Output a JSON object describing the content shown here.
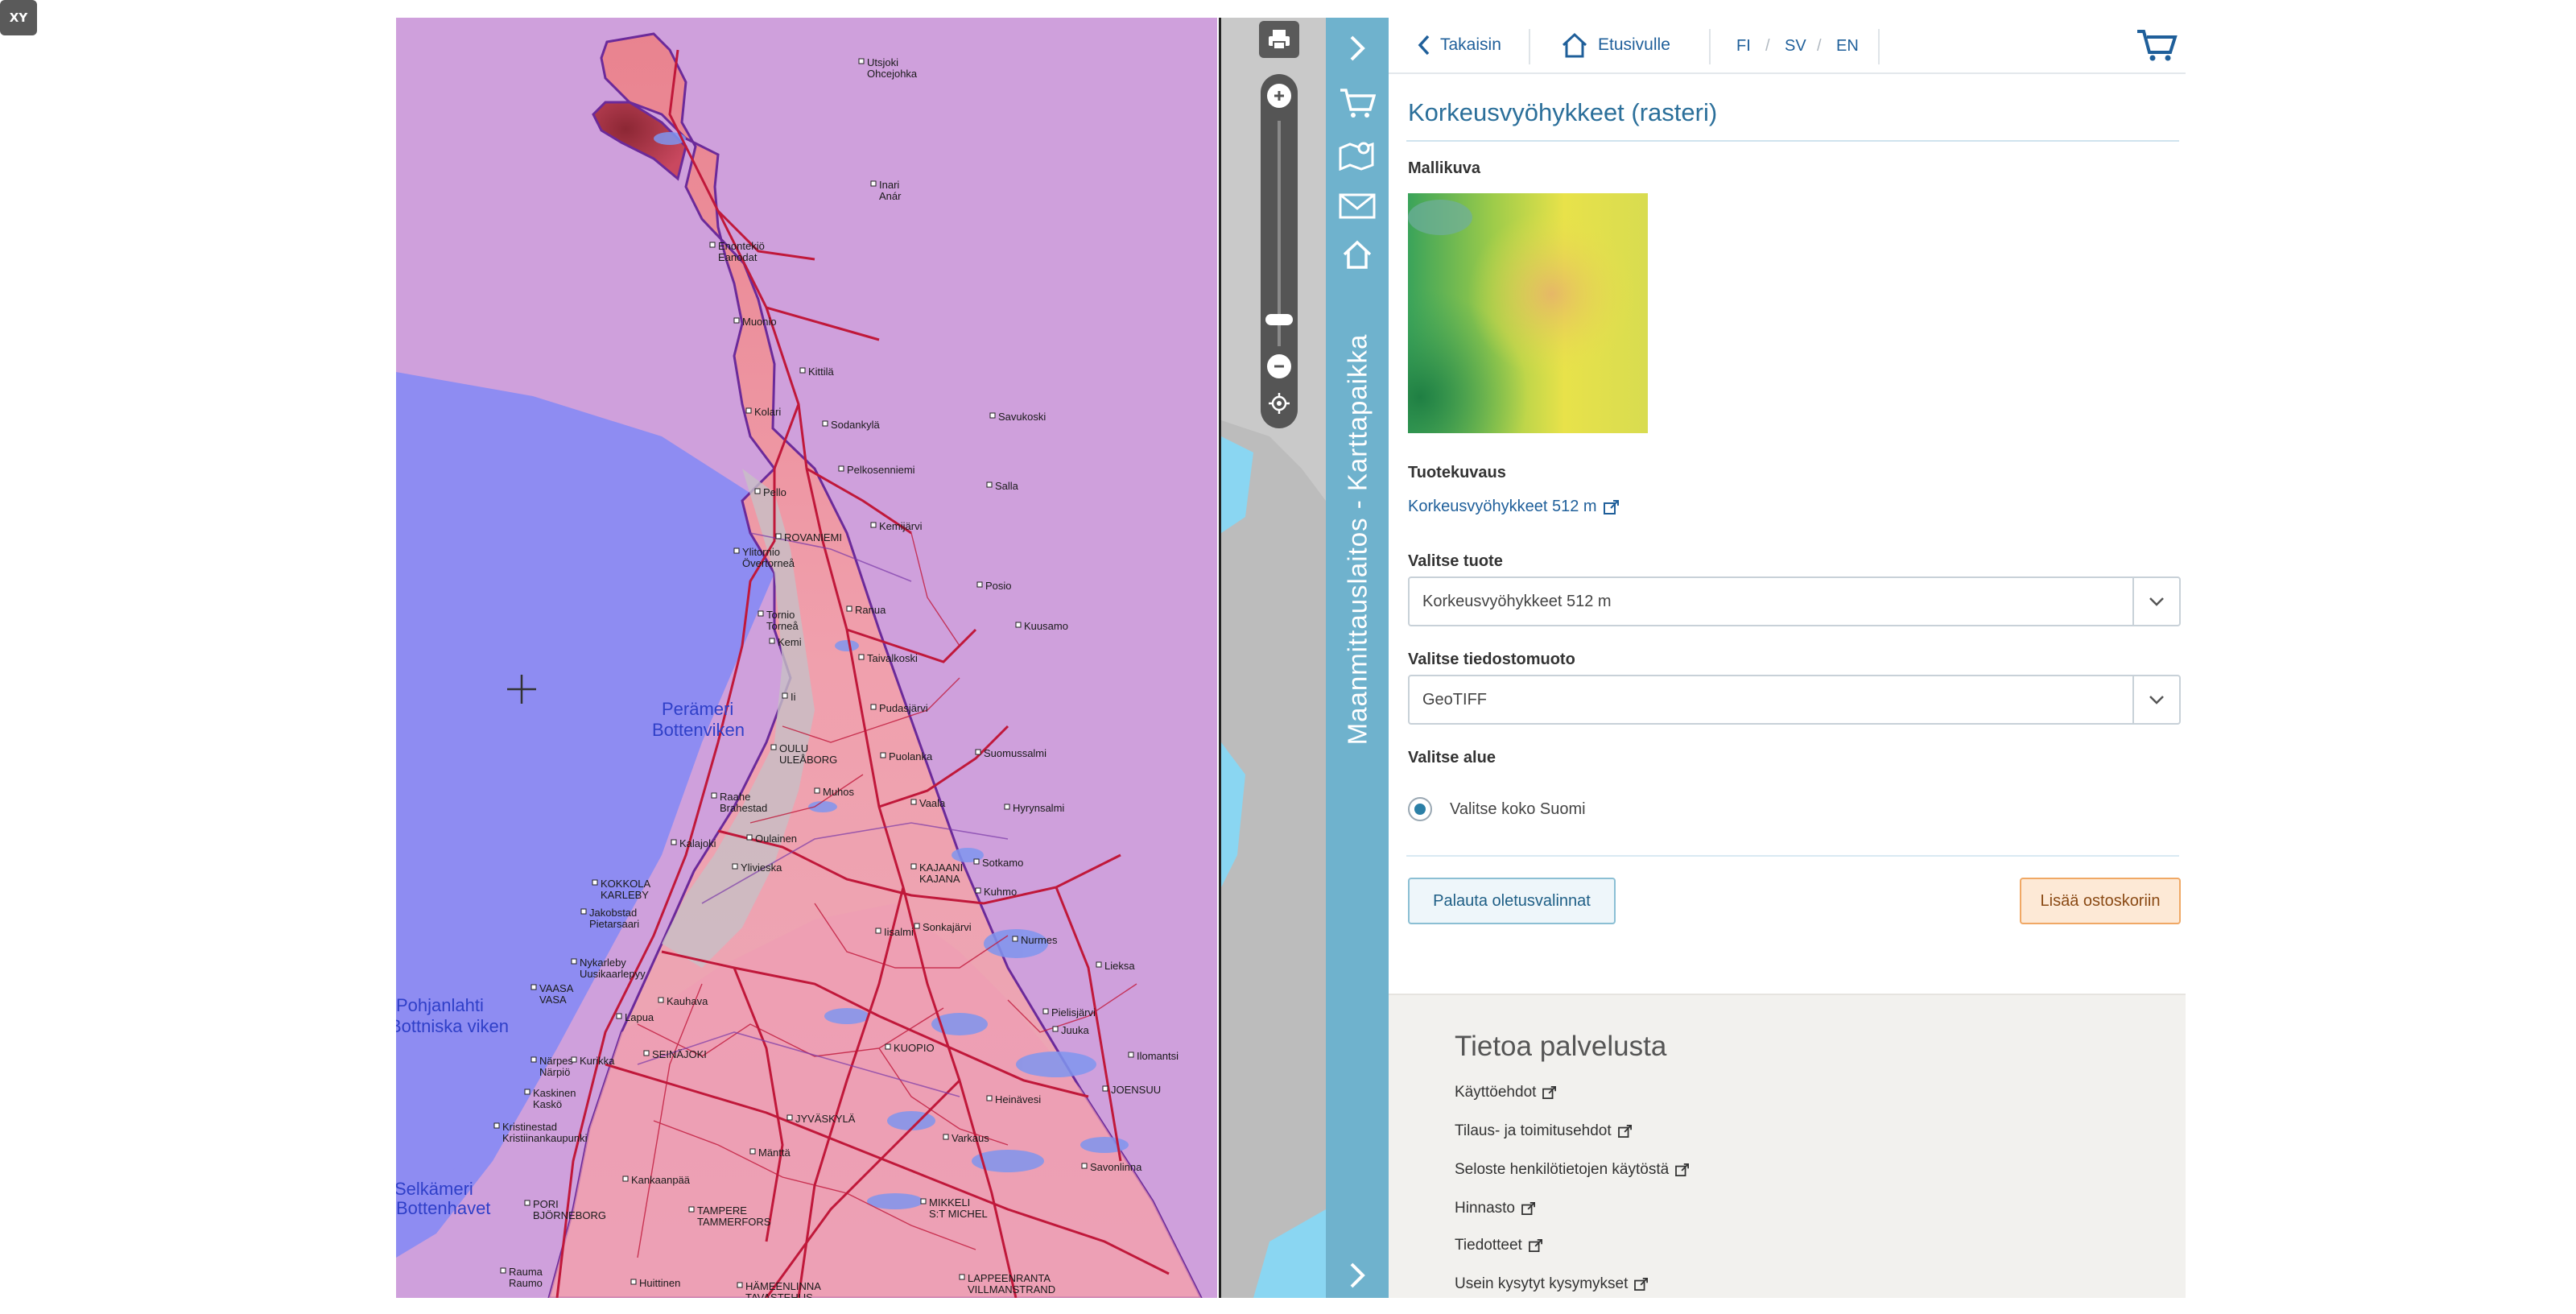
{
  "map": {
    "sea_labels": [
      "Perämeri",
      "Bottenviken",
      "Pohjanlahti",
      "Bottniska viken",
      "Selkämeri",
      "Bottenhavet"
    ],
    "places": [
      {
        "name": "Utsjoki",
        "sub": "Ohcejohka"
      },
      {
        "name": "Inari",
        "sub": "Anár"
      },
      {
        "name": "Enontekiö",
        "sub": "Eanodat"
      },
      {
        "name": "Muonio"
      },
      {
        "name": "Kittilä"
      },
      {
        "name": "Kolari"
      },
      {
        "name": "Sodankylä"
      },
      {
        "name": "Savukoski"
      },
      {
        "name": "Pelkosenniemi"
      },
      {
        "name": "Salla"
      },
      {
        "name": "Pello"
      },
      {
        "name": "ROVANIEMI"
      },
      {
        "name": "Kemijärvi"
      },
      {
        "name": "Ylitornio",
        "sub": "Övertorneå"
      },
      {
        "name": "Posio"
      },
      {
        "name": "Tornio",
        "sub": "Torneå"
      },
      {
        "name": "Kemi"
      },
      {
        "name": "Ranua"
      },
      {
        "name": "Kuusamo"
      },
      {
        "name": "Taivalkoski"
      },
      {
        "name": "Ii"
      },
      {
        "name": "Pudasjärvi"
      },
      {
        "name": "OULU",
        "sub": "ULEÅBORG"
      },
      {
        "name": "Suomussalmi"
      },
      {
        "name": "Muhos"
      },
      {
        "name": "Puolanka"
      },
      {
        "name": "Raahe",
        "sub": "Brahestad"
      },
      {
        "name": "Vaala"
      },
      {
        "name": "Hyrynsalmi"
      },
      {
        "name": "Kalajoki"
      },
      {
        "name": "Oulainen"
      },
      {
        "name": "Ylivieska"
      },
      {
        "name": "Sotkamo"
      },
      {
        "name": "KAJAANI",
        "sub": "KAJANA"
      },
      {
        "name": "KOKKOLA",
        "sub": "KARLEBY"
      },
      {
        "name": "Jakobstad",
        "sub": "Pietarsaari"
      },
      {
        "name": "Kuhmo"
      },
      {
        "name": "Sonkajärvi"
      },
      {
        "name": "Nurmes"
      },
      {
        "name": "Iisalmi"
      },
      {
        "name": "Nykarleby",
        "sub": "Uusikaarlepyy"
      },
      {
        "name": "Lieksa"
      },
      {
        "name": "VAASA",
        "sub": "VASA"
      },
      {
        "name": "Lapua"
      },
      {
        "name": "Kauhava"
      },
      {
        "name": "Pielisjärvi"
      },
      {
        "name": "KUOPIO"
      },
      {
        "name": "Juuka"
      },
      {
        "name": "SEINÄJOKI"
      },
      {
        "name": "Närpes",
        "sub": "Närpiö"
      },
      {
        "name": "Kurikka"
      },
      {
        "name": "Ilomantsi"
      },
      {
        "name": "JOENSUU"
      },
      {
        "name": "Kaskinen",
        "sub": "Kaskö"
      },
      {
        "name": "Kristinestad",
        "sub": "Kristiinankaupunki"
      },
      {
        "name": "JYVÄSKYLÄ"
      },
      {
        "name": "Varkaus"
      },
      {
        "name": "Heinävesi"
      },
      {
        "name": "Kankaanpää"
      },
      {
        "name": "Mänttä"
      },
      {
        "name": "Savonlinna"
      },
      {
        "name": "PORI",
        "sub": "BJÖRNEBORG"
      },
      {
        "name": "TAMPERE",
        "sub": "TAMMERFORS"
      },
      {
        "name": "MIKKELI",
        "sub": "S:T MICHEL"
      },
      {
        "name": "Rauma",
        "sub": "Raumo"
      },
      {
        "name": "Huittinen"
      },
      {
        "name": "HÄMEENLINNA",
        "sub": "TAVASTEHUS"
      },
      {
        "name": "LAPPEENRANTA",
        "sub": "VILLMANSTRAND"
      }
    ]
  },
  "tools": {
    "print_icon": "printer-icon",
    "zoom_in_icon": "plus-icon",
    "zoom_out_icon": "minus-icon",
    "locate_icon": "crosshair-icon",
    "xy_label": "XY"
  },
  "toolbar": {
    "icons": [
      "chevron-right-icon",
      "cart-icon",
      "map-pin-icon",
      "envelope-icon",
      "home-icon"
    ],
    "title": "Maanmittauslaitos - Karttapaikka"
  },
  "nav": {
    "back_label": "Takaisin",
    "home_label": "Etusivulle",
    "lang_fi": "FI",
    "lang_sv": "SV",
    "lang_en": "EN",
    "lang_separator": "/"
  },
  "product": {
    "title": "Korkeusvyöhykkeet (rasteri)",
    "sample_label": "Mallikuva",
    "desc_label": "Tuotekuvaus",
    "desc_link": "Korkeusvyöhykkeet 512 m",
    "select_product_label": "Valitse tuote",
    "select_product_value": "Korkeusvyöhykkeet 512 m",
    "select_format_label": "Valitse tiedostomuoto",
    "select_format_value": "GeoTIFF",
    "select_area_label": "Valitse alue",
    "area_option": "Valitse koko Suomi",
    "reset_button": "Palauta oletusvalinnat",
    "add_to_cart_button": "Lisää ostoskoriin"
  },
  "info": {
    "title": "Tietoa palvelusta",
    "links": [
      "Käyttöehdot",
      "Tilaus- ja toimitusehdot",
      "Seloste henkilötietojen käytöstä",
      "Hinnasto",
      "Tiedotteet",
      "Usein kysytyt kysymykset"
    ]
  },
  "colors": {
    "toolbar_blue": "#6fb2cd",
    "link_blue": "#1f5f9a",
    "sea": "#8e8cf2",
    "outside_area": "#cfa0dc",
    "land": "#ef9fb4",
    "roads": "#c0183a"
  }
}
